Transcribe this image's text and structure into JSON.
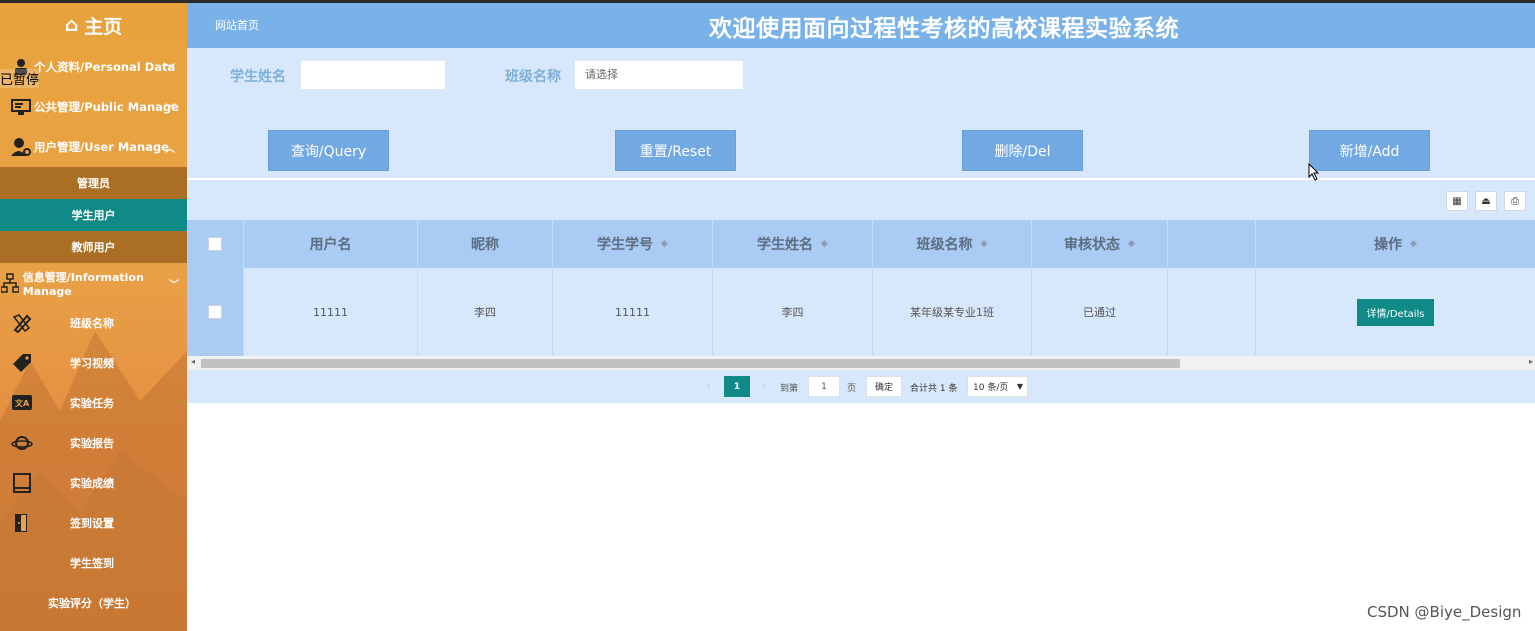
{
  "sidebar": {
    "home_label": "主页",
    "paused_label": "已暂停",
    "groups": {
      "personal": "个人资料/Personal Data",
      "public": "公共管理/Public Manage",
      "user": "用户管理/User Manage",
      "info": "信息管理/Information Manage"
    },
    "user_items": [
      "管理员",
      "学生用户",
      "教师用户"
    ],
    "active_item": "学生用户",
    "info_items": [
      "班级名称",
      "学习视频",
      "实验任务",
      "实验报告",
      "实验成绩",
      "签到设置",
      "学生签到",
      "实验评分（学生）"
    ]
  },
  "header": {
    "home_link": "网站首页",
    "title": "欢迎使用面向过程性考核的高校课程实验系统"
  },
  "search": {
    "student_name_label": "学生姓名",
    "student_name_value": "",
    "class_name_label": "班级名称",
    "class_name_placeholder": "请选择"
  },
  "buttons": {
    "query": "查询/Query",
    "reset": "重置/Reset",
    "delete": "删除/Del",
    "add": "新增/Add"
  },
  "table": {
    "columns": [
      "用户名",
      "昵称",
      "学生学号",
      "学生姓名",
      "班级名称",
      "审核状态",
      "",
      "操作"
    ],
    "rows": [
      {
        "username": "11111",
        "nickname": "李四",
        "student_no": "11111",
        "student_name": "李四",
        "class_name": "某年级某专业1班",
        "status": "已通过",
        "action": "详情/Details"
      }
    ]
  },
  "pagination": {
    "prev": "‹",
    "current_page": "1",
    "next": "›",
    "goto_label": "到第",
    "goto_value": "1",
    "page_unit": "页",
    "confirm": "确定",
    "total": "合计共 1 条",
    "page_size": "10 条/页"
  },
  "watermark": "CSDN @Biye_Design",
  "colors": {
    "header": "#79b2e8",
    "panel": "#d8e8fc",
    "accent_teal": "#0f8a87",
    "button": "#72a9e3",
    "sidebar": "#e8a23c"
  }
}
